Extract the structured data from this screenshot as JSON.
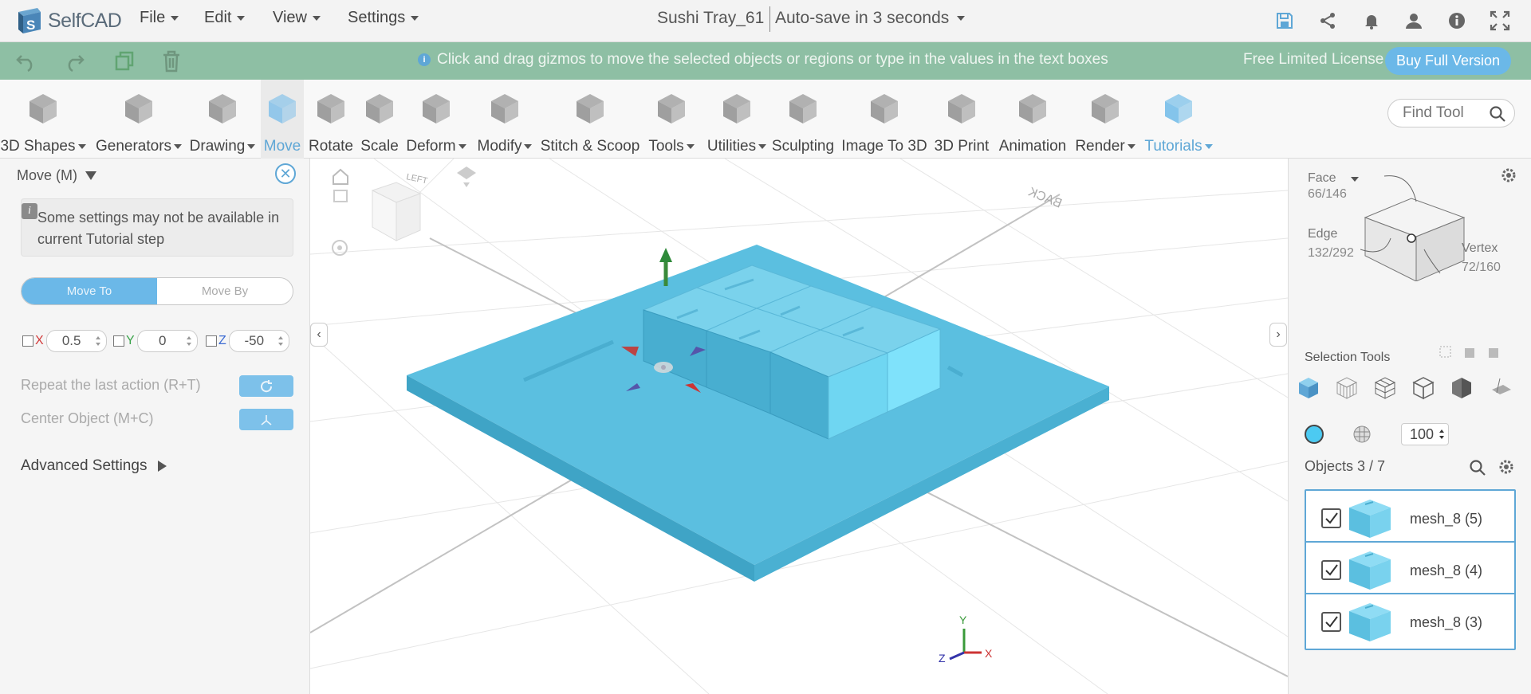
{
  "app": {
    "brand": "SelfCAD",
    "menus": [
      "File",
      "Edit",
      "View",
      "Settings"
    ],
    "doc_title": "Sushi Tray_61",
    "autosave": "Auto-save in 3 seconds"
  },
  "infobar": {
    "message": "Click and drag gizmos to move the selected objects or regions or type in the values in the text boxes",
    "license": "Free Limited License",
    "buy": "Buy Full Version"
  },
  "toolbar": {
    "tools": [
      {
        "label": "3D Shapes",
        "caret": true
      },
      {
        "label": "Generators",
        "caret": true
      },
      {
        "label": "Drawing",
        "caret": true
      },
      {
        "label": "Move",
        "caret": false
      },
      {
        "label": "Rotate",
        "caret": false
      },
      {
        "label": "Scale",
        "caret": false
      },
      {
        "label": "Deform",
        "caret": true
      },
      {
        "label": "Modify",
        "caret": true
      },
      {
        "label": "Stitch & Scoop",
        "caret": false
      },
      {
        "label": "Tools",
        "caret": true
      },
      {
        "label": "Utilities",
        "caret": true
      },
      {
        "label": "Sculpting",
        "caret": false
      },
      {
        "label": "Image To 3D",
        "caret": false
      },
      {
        "label": "3D Print",
        "caret": false
      },
      {
        "label": "Animation",
        "caret": false
      },
      {
        "label": "Render",
        "caret": true
      },
      {
        "label": "Tutorials",
        "caret": true
      }
    ],
    "find_placeholder": "Find Tool"
  },
  "left_panel": {
    "title": "Move (M)",
    "note": "Some settings may not be available in current Tutorial step",
    "move_to": "Move To",
    "move_by": "Move By",
    "x_label": "X",
    "x_value": "0.5",
    "y_label": "Y",
    "y_value": "0",
    "z_label": "Z",
    "z_value": "-50",
    "repeat": "Repeat the last action (R+T)",
    "center": "Center Object (M+C)",
    "advanced": "Advanced Settings"
  },
  "viewport": {
    "back_label": "BACK",
    "cube_left": "LEFT",
    "axes": {
      "x": "X",
      "y": "Y",
      "z": "Z"
    }
  },
  "right_panel": {
    "face_label": "Face",
    "face_count": "66/146",
    "edge_label": "Edge",
    "edge_count": "132/292",
    "vertex_label": "Vertex",
    "vertex_count": "72/160",
    "selection_tools": "Selection Tools",
    "opacity": "100",
    "objects_head": "Objects 3 / 7",
    "objects": [
      {
        "name": "mesh_8 (5)"
      },
      {
        "name": "mesh_8 (4)"
      },
      {
        "name": "mesh_8 (3)"
      }
    ]
  },
  "colors": {
    "accent": "#5fa7d6",
    "infobar": "#8ebfa4",
    "mesh": "#5bbfe0"
  }
}
